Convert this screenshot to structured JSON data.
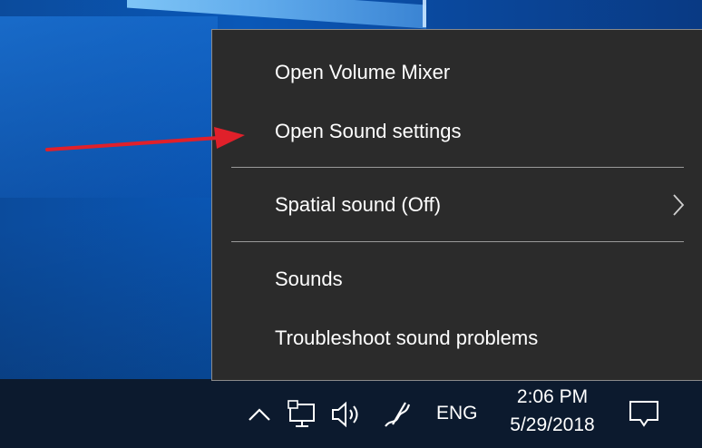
{
  "menu": {
    "items": [
      {
        "label": "Open Volume Mixer"
      },
      {
        "label": "Open Sound settings"
      },
      {
        "label": "Spatial sound (Off)",
        "submenu": true
      },
      {
        "label": "Sounds"
      },
      {
        "label": "Troubleshoot sound problems"
      }
    ]
  },
  "taskbar": {
    "language": "ENG",
    "time": "2:06 PM",
    "date": "5/29/2018",
    "icons": [
      "chevron-up-icon",
      "network-icon",
      "volume-icon",
      "pen-workspace-icon",
      "action-center-icon"
    ]
  },
  "colors": {
    "menu_bg": "#2b2b2b",
    "menu_text": "#ffffff",
    "separator": "#9a9a9a",
    "annotation_arrow": "#e0202a",
    "taskbar_bg": "#0c1a2e"
  }
}
